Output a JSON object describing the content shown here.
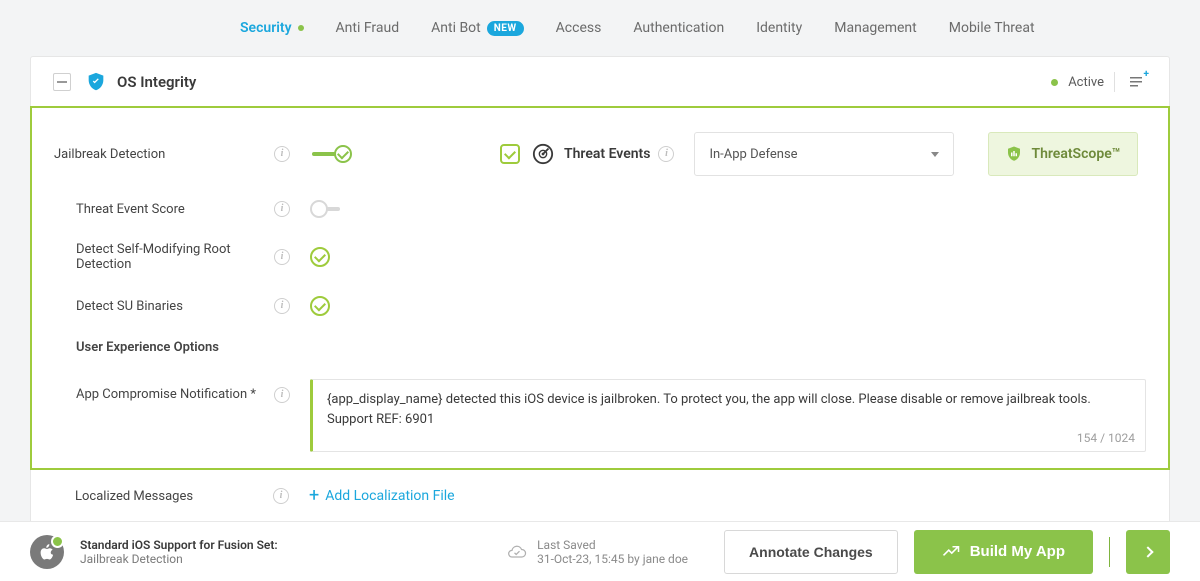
{
  "nav": {
    "tabs": [
      "Security",
      "Anti Fraud",
      "Anti Bot",
      "Access",
      "Authentication",
      "Identity",
      "Management",
      "Mobile Threat"
    ],
    "new_badge": "NEW"
  },
  "panel": {
    "title": "OS Integrity",
    "status": "Active"
  },
  "rows": {
    "jailbreak": "Jailbreak Detection",
    "threat_events": "Threat Events",
    "defense_selected": "In-App Defense",
    "threatscope": "ThreatScope™",
    "threat_score": "Threat Event Score",
    "self_mod": "Detect Self-Modifying Root Detection",
    "su_bin": "Detect SU Binaries",
    "ux_options": "User Experience Options",
    "notif_label": "App Compromise Notification *",
    "notif_text": "{app_display_name} detected this iOS device is jailbroken. To protect you, the app will close. Please disable or remove jailbreak tools. Support REF: 6901",
    "char_count": "154 / 1024",
    "localized": "Localized Messages",
    "add_loc": "Add Localization File"
  },
  "footer": {
    "fusion_title": "Standard iOS Support for Fusion Set:",
    "fusion_sub": "Jailbreak Detection",
    "saved_label": "Last Saved",
    "saved_detail": "31-Oct-23, 15:45 by jane doe",
    "annotate": "Annotate Changes",
    "build": "Build My App"
  }
}
